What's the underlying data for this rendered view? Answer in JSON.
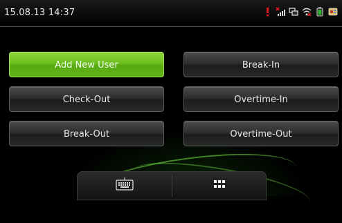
{
  "status_bar": {
    "datetime": "15.08.13 14:37",
    "icons": [
      "alert-icon",
      "signal-icon",
      "network-icon",
      "wifi-icon",
      "battery-icon",
      "ticket-icon"
    ]
  },
  "menu": {
    "add_new_user": "Add New User",
    "break_in": "Break-In",
    "check_out": "Check-Out",
    "overtime_in": "Overtime-In",
    "break_out": "Break-Out",
    "overtime_out": "Overtime-Out"
  },
  "dock": {
    "icons": [
      "keyboard-icon",
      "grid-menu-icon"
    ]
  },
  "colors": {
    "accent_green": "#6cbf1f",
    "background": "#000000"
  }
}
